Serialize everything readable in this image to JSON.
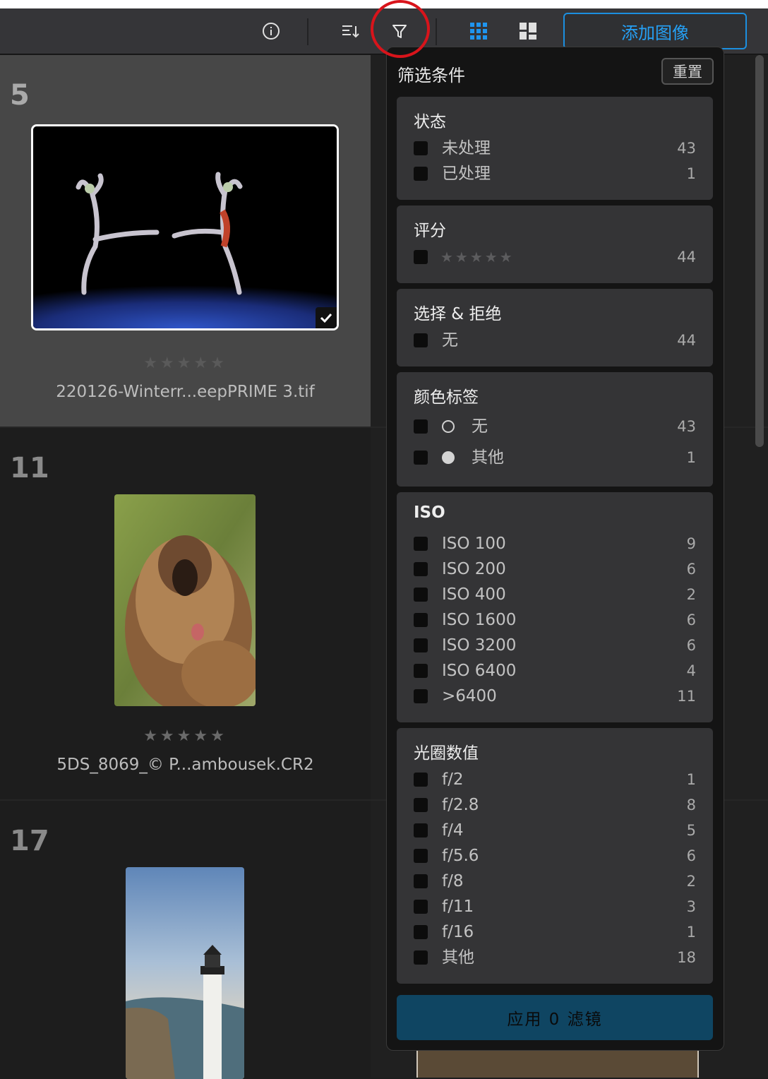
{
  "toolbar": {
    "add_images_label": "添加图像",
    "icons": [
      "info-icon",
      "sort-icon",
      "filter-icon",
      "grid-view-icon",
      "mosaic-view-icon"
    ]
  },
  "grid": {
    "items": [
      {
        "number": "5",
        "filename": "220126-Winterr...eepPRIME 3.tif",
        "rating": "★★★★★",
        "selected": true
      },
      {
        "number": "11",
        "filename": "5DS_8069_© P...ambousek.CR2",
        "rating": "★★★★★"
      },
      {
        "number": "17",
        "filename": "",
        "rating": ""
      }
    ]
  },
  "filter": {
    "title": "筛选条件",
    "reset_label": "重置",
    "sections": {
      "status": {
        "title": "状态",
        "options": [
          {
            "label": "未处理",
            "count": "43"
          },
          {
            "label": "已处理",
            "count": "1"
          }
        ]
      },
      "rating": {
        "title": "评分",
        "options": [
          {
            "label": "★★★★★",
            "count": "44"
          }
        ]
      },
      "pick_reject": {
        "title": "选择 & 拒绝",
        "options": [
          {
            "label": "无",
            "count": "44"
          }
        ]
      },
      "color_label": {
        "title": "颜色标签",
        "options": [
          {
            "label": "无",
            "count": "43"
          },
          {
            "label": "其他",
            "count": "1"
          }
        ]
      },
      "iso": {
        "title": "ISO",
        "options": [
          {
            "label": "ISO 100",
            "count": "9"
          },
          {
            "label": "ISO 200",
            "count": "6"
          },
          {
            "label": "ISO 400",
            "count": "2"
          },
          {
            "label": "ISO 1600",
            "count": "6"
          },
          {
            "label": "ISO 3200",
            "count": "6"
          },
          {
            "label": "ISO 6400",
            "count": "4"
          },
          {
            "label": ">6400",
            "count": "11"
          }
        ]
      },
      "aperture": {
        "title": "光圈数值",
        "options": [
          {
            "label": "f/2",
            "count": "1"
          },
          {
            "label": "f/2.8",
            "count": "8"
          },
          {
            "label": "f/4",
            "count": "5"
          },
          {
            "label": "f/5.6",
            "count": "6"
          },
          {
            "label": "f/8",
            "count": "2"
          },
          {
            "label": "f/11",
            "count": "3"
          },
          {
            "label": "f/16",
            "count": "1"
          },
          {
            "label": "其他",
            "count": "18"
          }
        ]
      }
    },
    "apply_label": "应用 0 滤镜"
  },
  "colors": {
    "accent": "#25a0f5",
    "annotation": "#d8141b",
    "apply_button": "#0f4562"
  }
}
